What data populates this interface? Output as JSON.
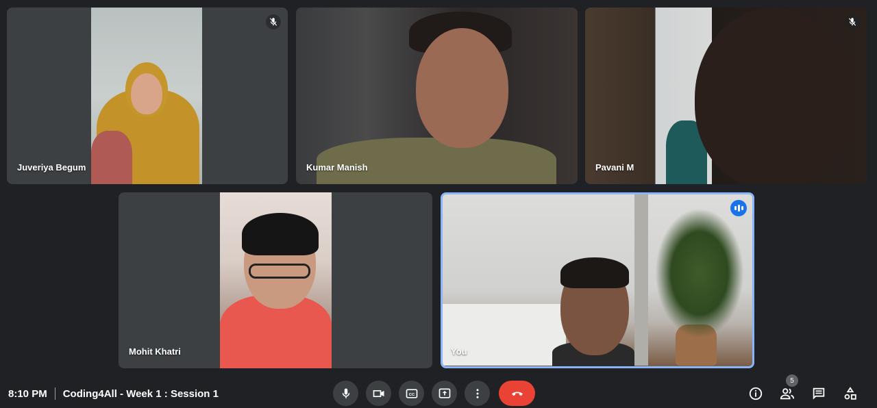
{
  "participants": [
    {
      "name": "Juveriya Begum",
      "muted": true
    },
    {
      "name": "Kumar Manish",
      "muted": false
    },
    {
      "name": "Pavani M",
      "muted": true
    },
    {
      "name": "Mohit Khatri",
      "muted": false
    },
    {
      "name": "You",
      "speaking": true
    }
  ],
  "footer": {
    "time": "8:10 PM",
    "meeting_title": "Coding4All - Week 1 : Session 1"
  },
  "controls": {
    "mic_icon": "microphone-icon",
    "camera_icon": "video-camera-icon",
    "captions_icon": "closed-captions-icon",
    "present_icon": "present-screen-icon",
    "more_icon": "more-options-icon",
    "end_call_icon": "end-call-icon"
  },
  "right_panel": {
    "people_count": "5",
    "icons": [
      "info-icon",
      "people-icon",
      "chat-icon",
      "activities-icon"
    ]
  },
  "colors": {
    "background": "#202124",
    "tile": "#3c4043",
    "end_call": "#ea4335",
    "active_speaker_border": "#8ab4f8",
    "speaking_badge": "#1a73e8"
  }
}
